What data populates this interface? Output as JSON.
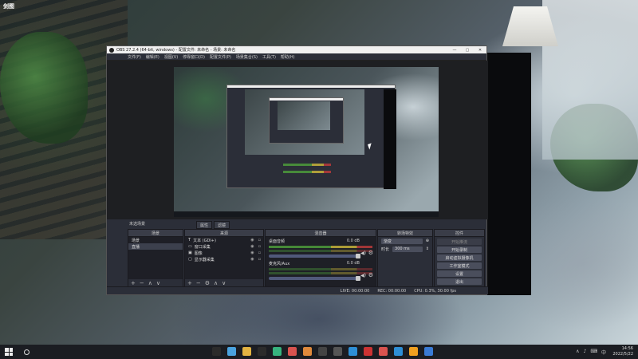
{
  "desktop": {
    "corner_label": "剑图"
  },
  "obs": {
    "window_title": "OBS 27.2.4 (64-bit, windows) - 配置文件: 未命名 - 场景: 未命名",
    "window_buttons": {
      "minimize": "—",
      "maximize": "▢",
      "close": "✕"
    },
    "menu": [
      "文件(F)",
      "编辑(E)",
      "视图(V)",
      "停靠窗口(D)",
      "配置文件(P)",
      "场景集合(S)",
      "工具(T)",
      "帮助(H)"
    ],
    "scene_label": "未选场景",
    "tabs": [
      "属性",
      "滤镜"
    ],
    "scenes": {
      "header": "场景",
      "items": [
        "场景",
        "直播"
      ]
    },
    "sources": {
      "header": "来源",
      "items": [
        {
          "icon": "T",
          "label": "文本 (GDI+)"
        },
        {
          "icon": "▭",
          "label": "窗口采集"
        },
        {
          "icon": "▣",
          "label": "图像"
        },
        {
          "icon": "▢",
          "label": "显示器采集"
        }
      ]
    },
    "mixer": {
      "header": "混音器",
      "tracks": [
        {
          "name": "桌面音频",
          "db": "0.0 dB"
        },
        {
          "name": "麦克风/Aux",
          "db": "0.0 dB"
        }
      ]
    },
    "transitions": {
      "header": "转场特效",
      "type": "渐变",
      "duration_label": "时长",
      "duration_value": "300 ms"
    },
    "controls": {
      "header": "控件",
      "buttons": [
        "开始推流",
        "开始录制",
        "启动虚拟摄像机",
        "工作室模式",
        "设置",
        "退出"
      ]
    },
    "footer_buttons": [
      "+",
      "−",
      "∧",
      "∨"
    ],
    "status": {
      "live": "LIVE: 00:00:00",
      "rec": "REC: 00:00:00",
      "cpu": "CPU: 0.3%, 30.00 fps"
    }
  },
  "taskbar": {
    "app_colors": [
      "#2b2b2b",
      "#4aa3df",
      "#e3b341",
      "#2b2b2b",
      "#36b37e",
      "#d9534f",
      "#e08a3c",
      "#444444",
      "#555555",
      "#2e8fd6",
      "#cc3333",
      "#d9534f",
      "#2e8fd6",
      "#f0a020",
      "#3a7bd5"
    ],
    "tray": [
      "∧",
      "♪",
      "⌨",
      "中"
    ],
    "time": "14:56",
    "date": "2022/5/22"
  }
}
